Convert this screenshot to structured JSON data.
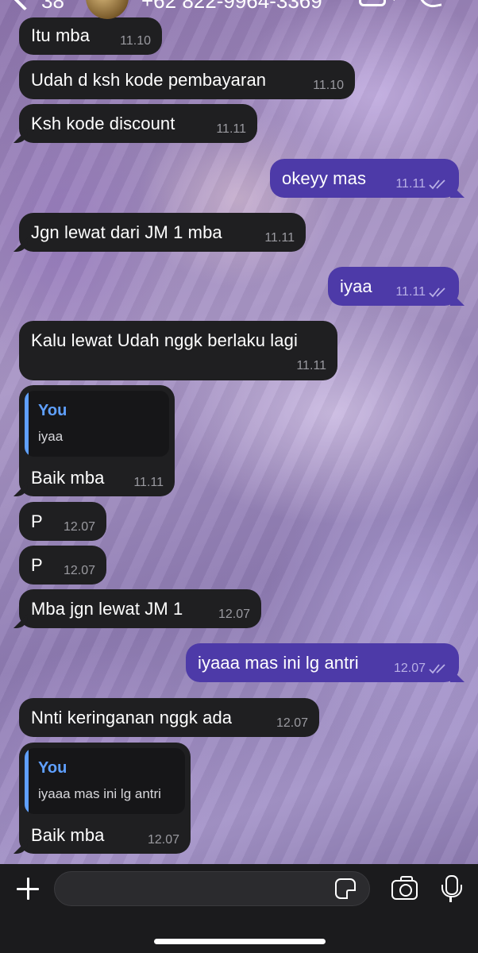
{
  "header": {
    "unread_count": "38",
    "contact_name": "+62 822-9964-3369",
    "avatar_icon": "contact-avatar",
    "back_icon": "chevron-left-icon",
    "video_icon": "video-camera-icon",
    "phone_icon": "phone-icon"
  },
  "messages": [
    {
      "dir": "in",
      "text": "Itu mba",
      "time": "11.10"
    },
    {
      "dir": "in",
      "text": "Udah d ksh kode pembayaran",
      "time": "11.10"
    },
    {
      "dir": "in",
      "text": "Ksh kode discount",
      "time": "11.11"
    },
    {
      "dir": "out",
      "text": "okeyy mas",
      "time": "11.11",
      "read": true
    },
    {
      "dir": "in",
      "text": "Jgn lewat dari JM 1 mba",
      "time": "11.11"
    },
    {
      "dir": "out",
      "text": "iyaa",
      "time": "11.11",
      "read": true
    },
    {
      "dir": "in",
      "text": "Kalu lewat Udah nggk berlaku lagi",
      "time": "11.11"
    },
    {
      "dir": "in",
      "text": "Baik mba",
      "time": "11.11",
      "reply": {
        "author": "You",
        "text": "iyaa"
      }
    },
    {
      "dir": "in",
      "text": "P",
      "time": "12.07"
    },
    {
      "dir": "in",
      "text": "P",
      "time": "12.07"
    },
    {
      "dir": "in",
      "text": "Mba jgn lewat JM 1",
      "time": "12.07"
    },
    {
      "dir": "out",
      "text": "iyaaa mas ini lg antri",
      "time": "12.07",
      "read": true
    },
    {
      "dir": "in",
      "text": "Nnti keringanan nggk ada",
      "time": "12.07"
    },
    {
      "dir": "in",
      "text": "Baik mba",
      "time": "12.07",
      "reply": {
        "author": "You",
        "text": "iyaaa mas ini lg antri"
      }
    }
  ],
  "input_bar": {
    "message_value": "",
    "message_placeholder": "",
    "attach_icon": "plus-icon",
    "sticker_icon": "sticker-icon",
    "camera_icon": "camera-icon",
    "mic_icon": "microphone-icon"
  },
  "colors": {
    "incoming_bubble": "#1f1f21",
    "outgoing_bubble": "#4d3aa8",
    "reply_accent": "#5fa0ff",
    "timestamp": "#9a9aa0"
  }
}
